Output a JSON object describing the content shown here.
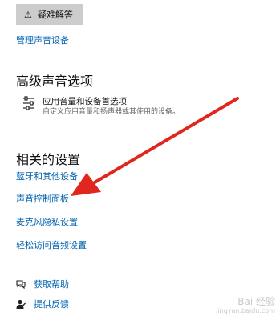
{
  "troubleshoot": {
    "icon": "warning-icon",
    "label": "疑难解答"
  },
  "manage_devices_link": "管理声音设备",
  "advanced": {
    "heading": "高级声音选项",
    "app_volume": {
      "icon": "sliders-icon",
      "title": "应用音量和设备首选项",
      "description": "自定义应用音量和扬声器或其使用的设备。"
    }
  },
  "related": {
    "heading": "相关的设置",
    "links": [
      "蓝牙和其他设备",
      "声音控制面板",
      "麦克风隐私设置",
      "轻松访问音频设置"
    ]
  },
  "help": [
    {
      "icon": "help-chat-icon",
      "label": "获取帮助"
    },
    {
      "icon": "feedback-icon",
      "label": "提供反馈"
    }
  ],
  "annotation": {
    "arrow_color": "#e0261d"
  },
  "watermark": {
    "line1": "Bai 经验",
    "line2": "jingyan.baidu.com"
  }
}
